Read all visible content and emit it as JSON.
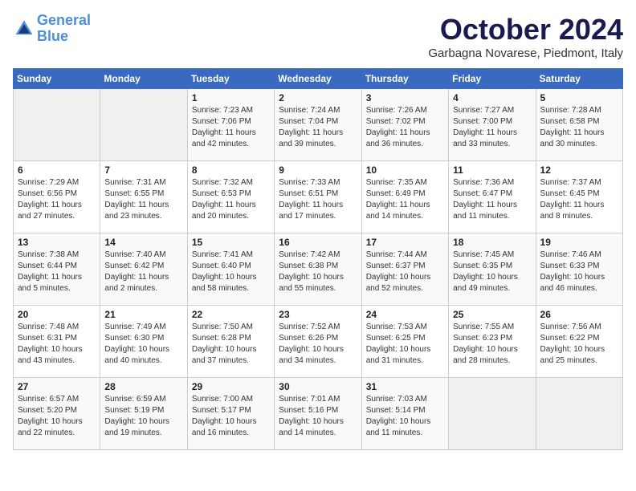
{
  "header": {
    "logo_line1": "General",
    "logo_line2": "Blue",
    "month_title": "October 2024",
    "subtitle": "Garbagna Novarese, Piedmont, Italy"
  },
  "days_of_week": [
    "Sunday",
    "Monday",
    "Tuesday",
    "Wednesday",
    "Thursday",
    "Friday",
    "Saturday"
  ],
  "weeks": [
    [
      {
        "day": "",
        "sunrise": "",
        "sunset": "",
        "daylight": "",
        "empty": true
      },
      {
        "day": "",
        "sunrise": "",
        "sunset": "",
        "daylight": "",
        "empty": true
      },
      {
        "day": "1",
        "sunrise": "Sunrise: 7:23 AM",
        "sunset": "Sunset: 7:06 PM",
        "daylight": "Daylight: 11 hours and 42 minutes."
      },
      {
        "day": "2",
        "sunrise": "Sunrise: 7:24 AM",
        "sunset": "Sunset: 7:04 PM",
        "daylight": "Daylight: 11 hours and 39 minutes."
      },
      {
        "day": "3",
        "sunrise": "Sunrise: 7:26 AM",
        "sunset": "Sunset: 7:02 PM",
        "daylight": "Daylight: 11 hours and 36 minutes."
      },
      {
        "day": "4",
        "sunrise": "Sunrise: 7:27 AM",
        "sunset": "Sunset: 7:00 PM",
        "daylight": "Daylight: 11 hours and 33 minutes."
      },
      {
        "day": "5",
        "sunrise": "Sunrise: 7:28 AM",
        "sunset": "Sunset: 6:58 PM",
        "daylight": "Daylight: 11 hours and 30 minutes."
      }
    ],
    [
      {
        "day": "6",
        "sunrise": "Sunrise: 7:29 AM",
        "sunset": "Sunset: 6:56 PM",
        "daylight": "Daylight: 11 hours and 27 minutes."
      },
      {
        "day": "7",
        "sunrise": "Sunrise: 7:31 AM",
        "sunset": "Sunset: 6:55 PM",
        "daylight": "Daylight: 11 hours and 23 minutes."
      },
      {
        "day": "8",
        "sunrise": "Sunrise: 7:32 AM",
        "sunset": "Sunset: 6:53 PM",
        "daylight": "Daylight: 11 hours and 20 minutes."
      },
      {
        "day": "9",
        "sunrise": "Sunrise: 7:33 AM",
        "sunset": "Sunset: 6:51 PM",
        "daylight": "Daylight: 11 hours and 17 minutes."
      },
      {
        "day": "10",
        "sunrise": "Sunrise: 7:35 AM",
        "sunset": "Sunset: 6:49 PM",
        "daylight": "Daylight: 11 hours and 14 minutes."
      },
      {
        "day": "11",
        "sunrise": "Sunrise: 7:36 AM",
        "sunset": "Sunset: 6:47 PM",
        "daylight": "Daylight: 11 hours and 11 minutes."
      },
      {
        "day": "12",
        "sunrise": "Sunrise: 7:37 AM",
        "sunset": "Sunset: 6:45 PM",
        "daylight": "Daylight: 11 hours and 8 minutes."
      }
    ],
    [
      {
        "day": "13",
        "sunrise": "Sunrise: 7:38 AM",
        "sunset": "Sunset: 6:44 PM",
        "daylight": "Daylight: 11 hours and 5 minutes."
      },
      {
        "day": "14",
        "sunrise": "Sunrise: 7:40 AM",
        "sunset": "Sunset: 6:42 PM",
        "daylight": "Daylight: 11 hours and 2 minutes."
      },
      {
        "day": "15",
        "sunrise": "Sunrise: 7:41 AM",
        "sunset": "Sunset: 6:40 PM",
        "daylight": "Daylight: 10 hours and 58 minutes."
      },
      {
        "day": "16",
        "sunrise": "Sunrise: 7:42 AM",
        "sunset": "Sunset: 6:38 PM",
        "daylight": "Daylight: 10 hours and 55 minutes."
      },
      {
        "day": "17",
        "sunrise": "Sunrise: 7:44 AM",
        "sunset": "Sunset: 6:37 PM",
        "daylight": "Daylight: 10 hours and 52 minutes."
      },
      {
        "day": "18",
        "sunrise": "Sunrise: 7:45 AM",
        "sunset": "Sunset: 6:35 PM",
        "daylight": "Daylight: 10 hours and 49 minutes."
      },
      {
        "day": "19",
        "sunrise": "Sunrise: 7:46 AM",
        "sunset": "Sunset: 6:33 PM",
        "daylight": "Daylight: 10 hours and 46 minutes."
      }
    ],
    [
      {
        "day": "20",
        "sunrise": "Sunrise: 7:48 AM",
        "sunset": "Sunset: 6:31 PM",
        "daylight": "Daylight: 10 hours and 43 minutes."
      },
      {
        "day": "21",
        "sunrise": "Sunrise: 7:49 AM",
        "sunset": "Sunset: 6:30 PM",
        "daylight": "Daylight: 10 hours and 40 minutes."
      },
      {
        "day": "22",
        "sunrise": "Sunrise: 7:50 AM",
        "sunset": "Sunset: 6:28 PM",
        "daylight": "Daylight: 10 hours and 37 minutes."
      },
      {
        "day": "23",
        "sunrise": "Sunrise: 7:52 AM",
        "sunset": "Sunset: 6:26 PM",
        "daylight": "Daylight: 10 hours and 34 minutes."
      },
      {
        "day": "24",
        "sunrise": "Sunrise: 7:53 AM",
        "sunset": "Sunset: 6:25 PM",
        "daylight": "Daylight: 10 hours and 31 minutes."
      },
      {
        "day": "25",
        "sunrise": "Sunrise: 7:55 AM",
        "sunset": "Sunset: 6:23 PM",
        "daylight": "Daylight: 10 hours and 28 minutes."
      },
      {
        "day": "26",
        "sunrise": "Sunrise: 7:56 AM",
        "sunset": "Sunset: 6:22 PM",
        "daylight": "Daylight: 10 hours and 25 minutes."
      }
    ],
    [
      {
        "day": "27",
        "sunrise": "Sunrise: 6:57 AM",
        "sunset": "Sunset: 5:20 PM",
        "daylight": "Daylight: 10 hours and 22 minutes."
      },
      {
        "day": "28",
        "sunrise": "Sunrise: 6:59 AM",
        "sunset": "Sunset: 5:19 PM",
        "daylight": "Daylight: 10 hours and 19 minutes."
      },
      {
        "day": "29",
        "sunrise": "Sunrise: 7:00 AM",
        "sunset": "Sunset: 5:17 PM",
        "daylight": "Daylight: 10 hours and 16 minutes."
      },
      {
        "day": "30",
        "sunrise": "Sunrise: 7:01 AM",
        "sunset": "Sunset: 5:16 PM",
        "daylight": "Daylight: 10 hours and 14 minutes."
      },
      {
        "day": "31",
        "sunrise": "Sunrise: 7:03 AM",
        "sunset": "Sunset: 5:14 PM",
        "daylight": "Daylight: 10 hours and 11 minutes."
      },
      {
        "day": "",
        "sunrise": "",
        "sunset": "",
        "daylight": "",
        "empty": true
      },
      {
        "day": "",
        "sunrise": "",
        "sunset": "",
        "daylight": "",
        "empty": true
      }
    ]
  ]
}
